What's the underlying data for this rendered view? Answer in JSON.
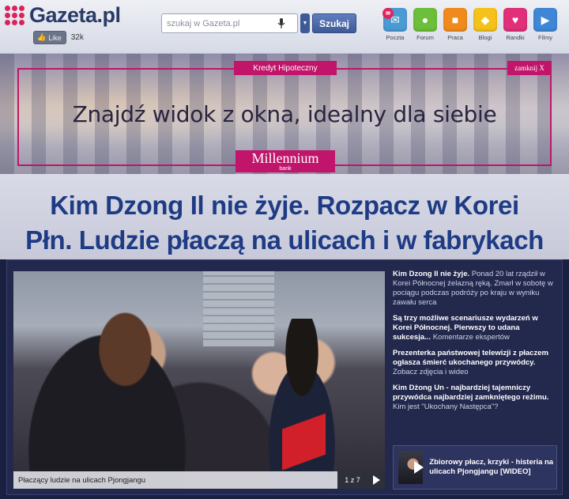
{
  "header": {
    "logo_text": "Gazeta.pl",
    "like_label": "Like",
    "like_count": "32k",
    "search": {
      "placeholder": "szukaj w Gazeta.pl",
      "button_label": "Szukaj"
    },
    "services": [
      {
        "label": "Poczta",
        "icon": "mail-icon",
        "color": "#4a9ad4"
      },
      {
        "label": "Forum",
        "icon": "chat-bubble-icon",
        "color": "#6bbf3a"
      },
      {
        "label": "Praca",
        "icon": "briefcase-icon",
        "color": "#f08a1c"
      },
      {
        "label": "Blogi",
        "icon": "blog-icon",
        "color": "#f4c21a"
      },
      {
        "label": "Randki",
        "icon": "heart-icon",
        "color": "#e0307a"
      },
      {
        "label": "Filmy",
        "icon": "play-icon",
        "color": "#3f86d6"
      }
    ]
  },
  "banner": {
    "tag": "Kredyt Hipoteczny",
    "close_label": "zamknij X",
    "text": "Znajdź widok z okna, idealny dla siebie",
    "brand": "Millennium",
    "brand_sub": "bank",
    "accent": "#c0156a"
  },
  "headline": {
    "line1": "Kim Dzong Il nie żyje. Rozpacz w Korei",
    "line2": "Płn. Ludzie płaczą na ulicach i w fabrykach"
  },
  "gallery": {
    "caption": "Płaczący ludzie na ulicach Pjongjangu",
    "counter": "1 z 7"
  },
  "news": [
    {
      "strong": "Kim Dzong Il nie żyje.",
      "light": " Ponad 20 lat rządził w Korei Północnej żelazną ręką. Zmarł w sobotę w pociągu podczas podróży po kraju w wyniku zawału serca"
    },
    {
      "strong": "Są trzy możliwe scenariusze wydarzeń w Korei Północnej. Pierwszy to udana sukcesja...",
      "light": " Komentarze ekspertów"
    },
    {
      "strong": "Prezenterka państwowej telewizji z płaczem ogłasza śmierć ukochanego przywódcy.",
      "light": " Zobacz zdjęcia i wideo"
    },
    {
      "strong": "Kim Dżong Un - najbardziej tajemniczy przywódca najbardziej zamkniętego reżimu.",
      "light": " Kim jest \"Ukochany Następca\"?"
    }
  ],
  "video": {
    "title": "Zbiorowy płacz, krzyki - histeria na ulicach Pjongjangu [WIDEO]"
  }
}
